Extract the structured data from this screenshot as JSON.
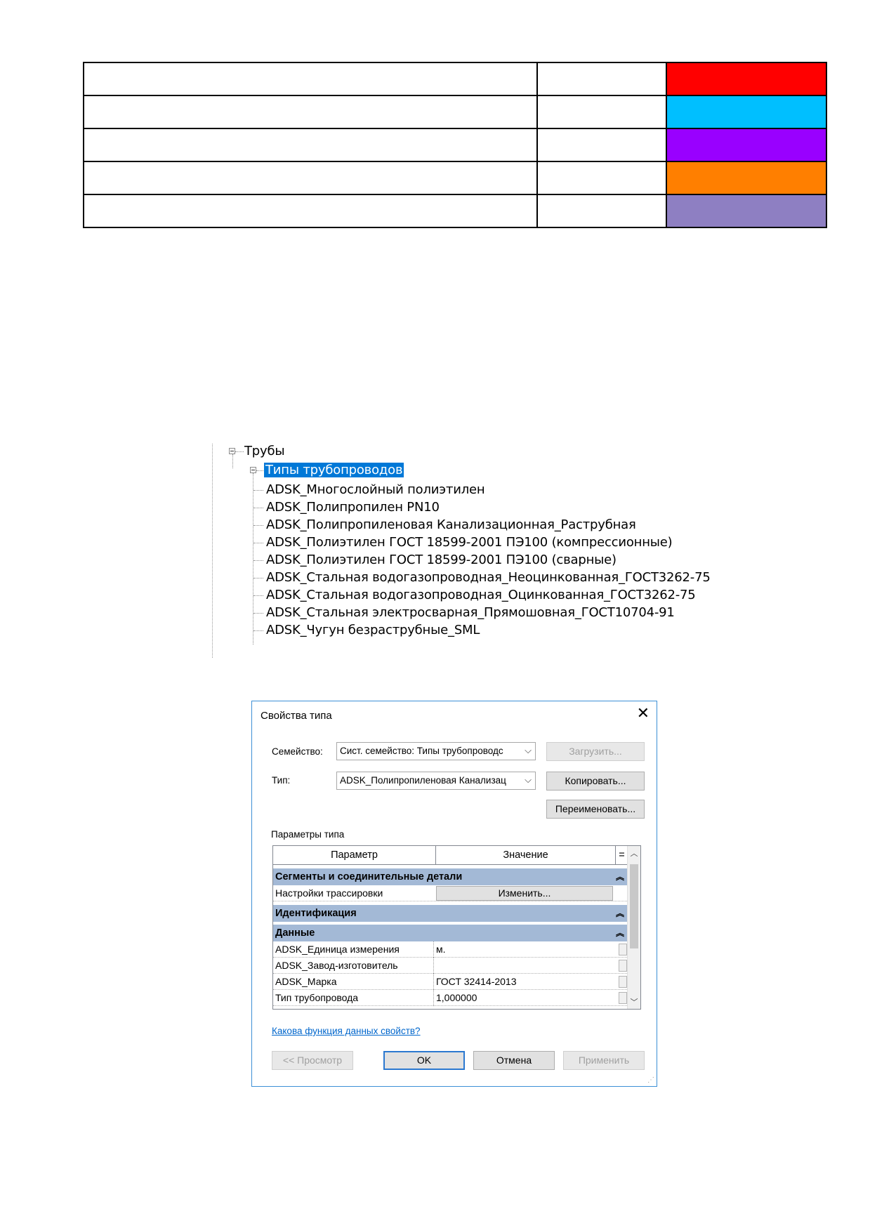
{
  "color_table": {
    "rows": [
      {
        "name": "",
        "code": "",
        "color": "#ff0000"
      },
      {
        "name": "",
        "code": "",
        "color": "#00bfff"
      },
      {
        "name": "",
        "code": "",
        "color": "#9900ff"
      },
      {
        "name": "",
        "code": "",
        "color": "#ff7f00"
      },
      {
        "name": "",
        "code": "",
        "color": "#8e7fc2"
      }
    ]
  },
  "tree": {
    "root_label": "Трубы",
    "group_label": "Типы трубопроводов",
    "items": [
      "ADSK_Многослойный полиэтилен",
      "ADSK_Полипропилен PN10",
      "ADSK_Полипропиленовая Канализационная_Раструбная",
      "ADSK_Полиэтилен ГОСТ 18599-2001 ПЭ100 (компрессионные)",
      "ADSK_Полиэтилен ГОСТ 18599-2001 ПЭ100 (сварные)",
      "ADSK_Стальная водогазопроводная_Неоцинкованная_ГОСТ3262-75",
      "ADSK_Стальная водогазопроводная_Оцинкованная_ГОСТ3262-75",
      "ADSK_Стальная электросварная_Прямошовная_ГОСТ10704-91",
      "ADSK_Чугун безраструбные_SML"
    ]
  },
  "dialog": {
    "title": "Свойства типа",
    "close_icon": "close-icon",
    "family_label": "Семейство:",
    "family_value": "Сист. семейство: Типы трубопроводс",
    "type_label": "Тип:",
    "type_value": "ADSK_Полипропиленовая Канализац",
    "load_button": "Загрузить...",
    "copy_button": "Копировать...",
    "rename_button": "Переименовать...",
    "params_label": "Параметры типа",
    "grid": {
      "col_param": "Параметр",
      "col_value": "Значение",
      "col_eq": "=",
      "groups": [
        {
          "label": "Сегменты и соединительные детали"
        },
        {
          "label": "Идентификация"
        },
        {
          "label": "Данные"
        }
      ],
      "routing_row": {
        "name": "Настройки трассировки",
        "button": "Изменить..."
      },
      "data_rows": [
        {
          "name": "ADSK_Единица измерения",
          "value": "м."
        },
        {
          "name": "ADSK_Завод-изготовитель",
          "value": ""
        },
        {
          "name": "ADSK_Марка",
          "value": "ГОСТ 32414-2013"
        },
        {
          "name": "Тип трубопровода",
          "value": "1,000000"
        }
      ]
    },
    "help_link": "Какова функция данных свойств?",
    "preview_button": "<< Просмотр",
    "ok_button": "OK",
    "cancel_button": "Отмена",
    "apply_button": "Применить"
  }
}
